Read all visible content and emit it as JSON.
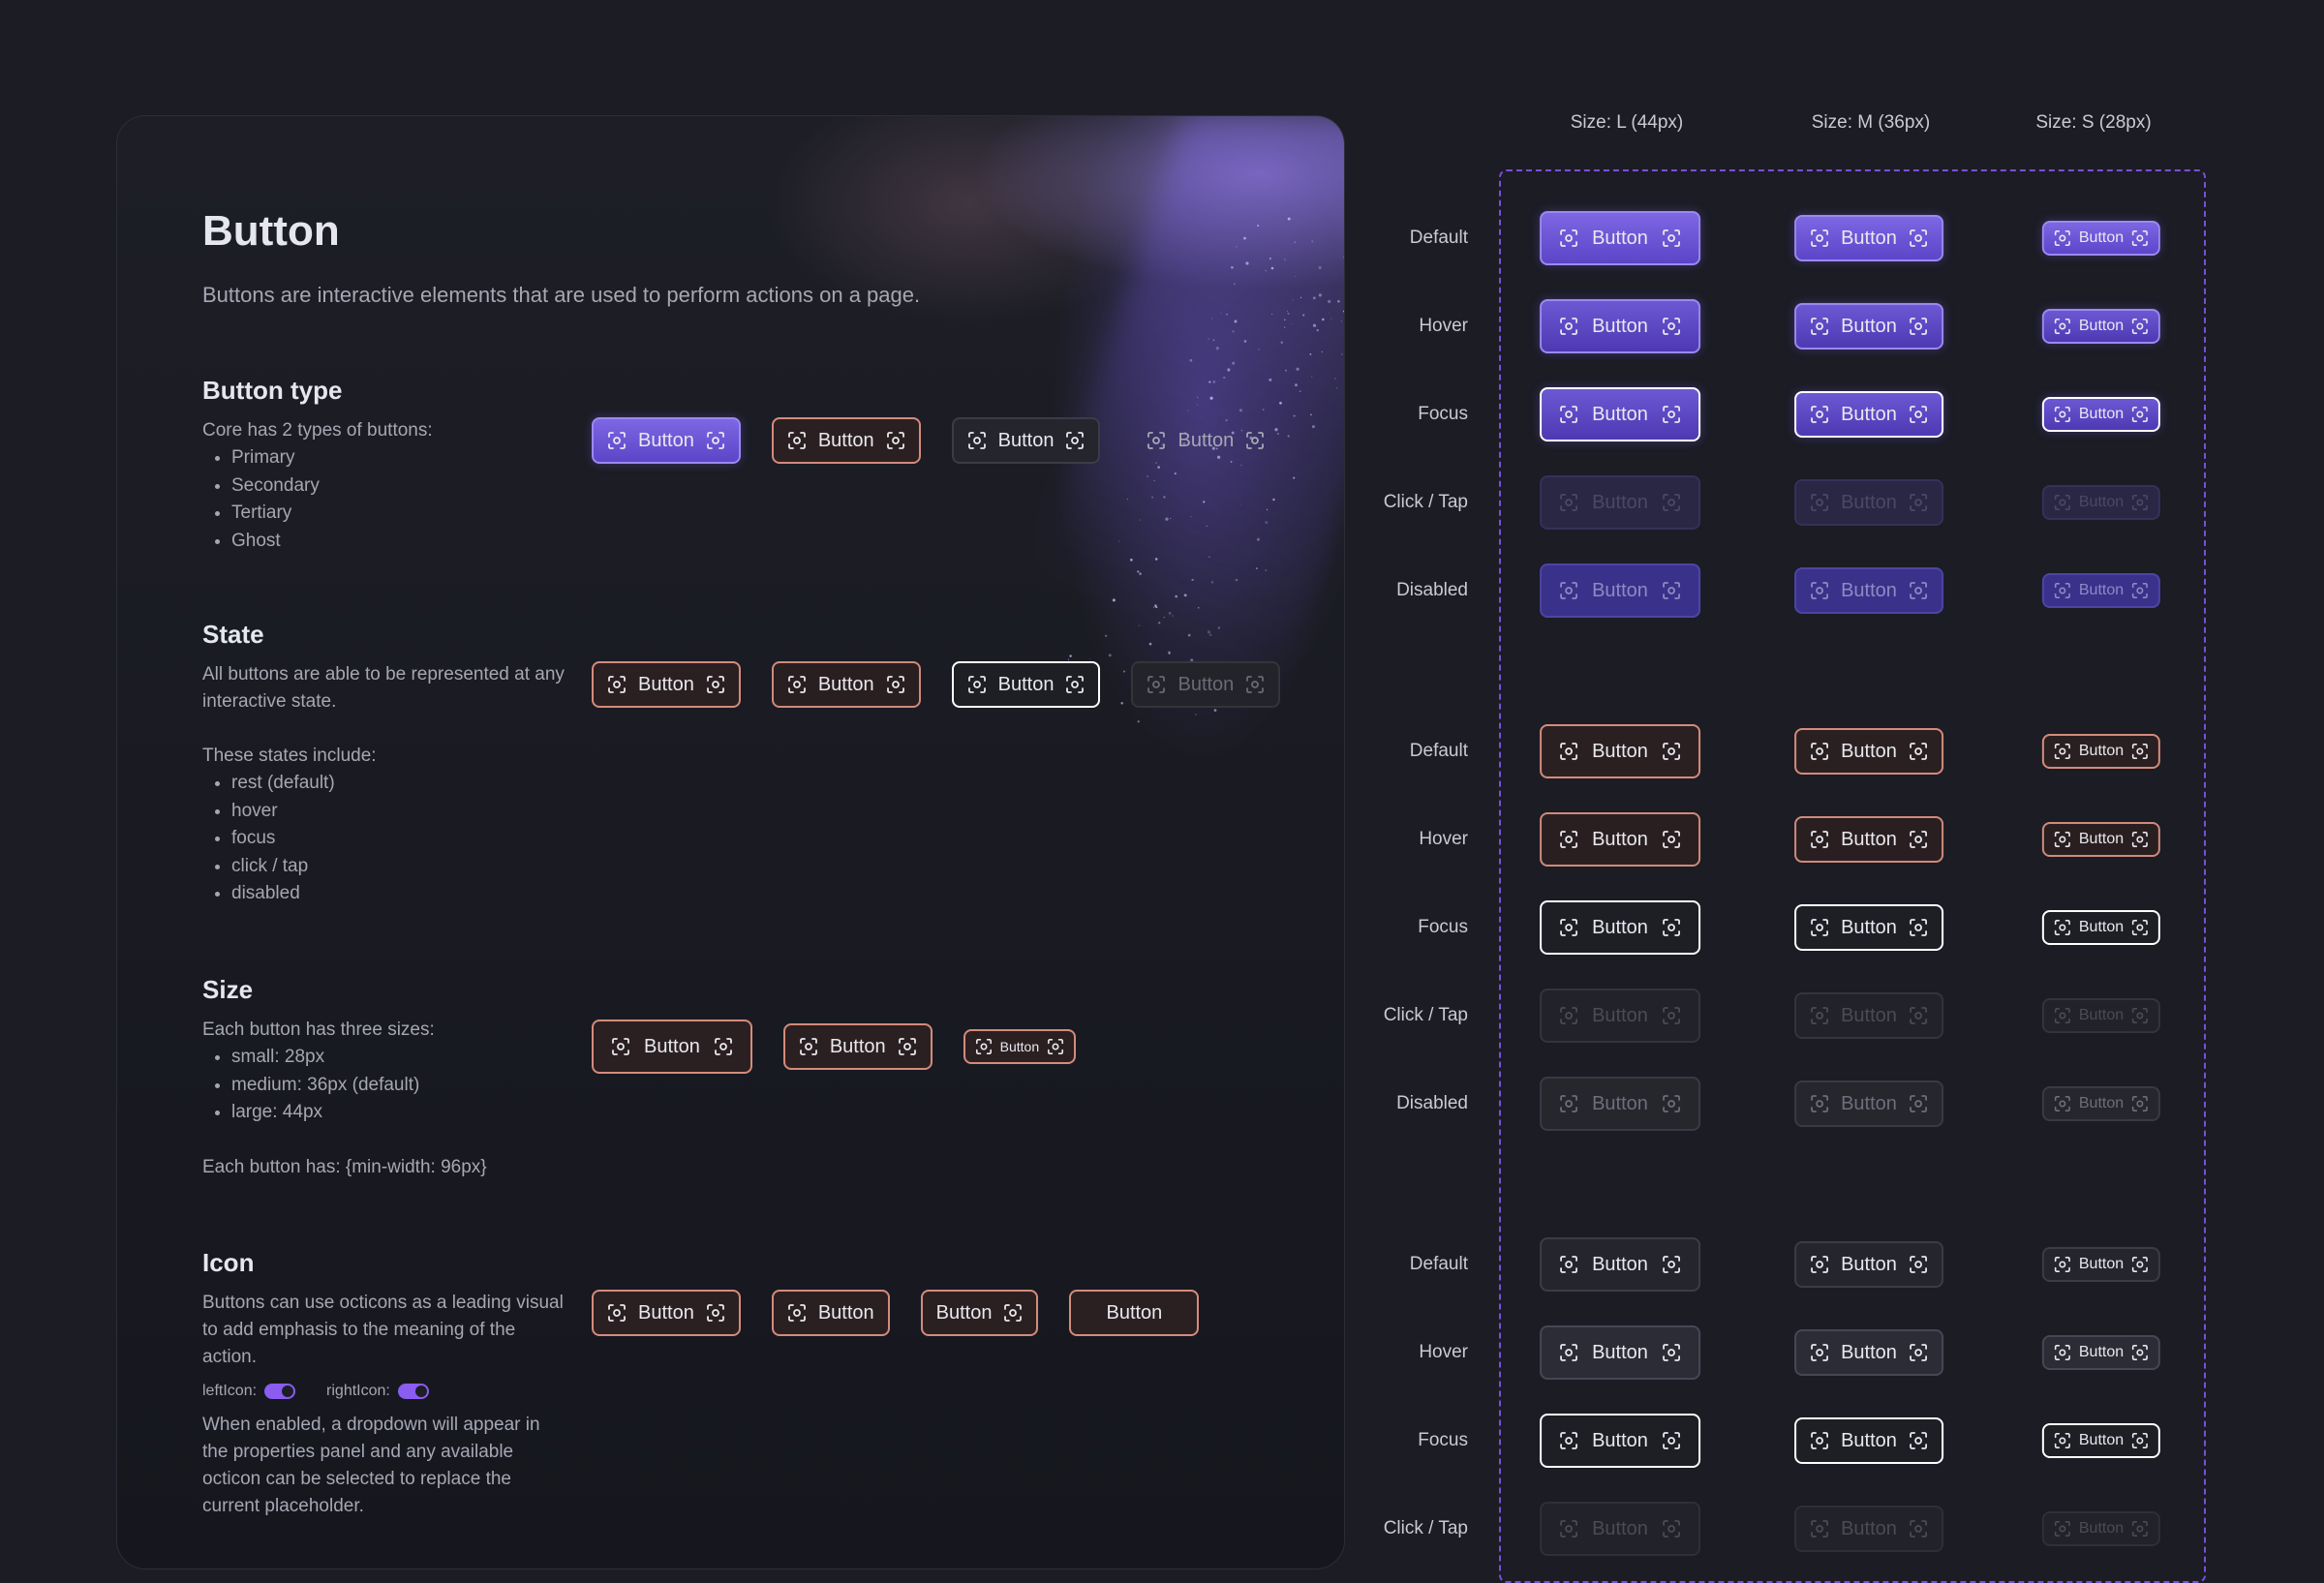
{
  "doc": {
    "title": "Button",
    "subtitle": "Buttons are interactive elements that are used to perform actions on a page.",
    "button_label": "Button",
    "type_section": {
      "heading": "Button type",
      "intro": "Core has 2 types of buttons:",
      "items": [
        "Primary",
        "Secondary",
        "Tertiary",
        "Ghost"
      ]
    },
    "state_section": {
      "heading": "State",
      "intro": "All buttons are able to be represented at any interactive state.",
      "intro2": "These states include:",
      "items": [
        "rest (default)",
        "hover",
        "focus",
        "click / tap",
        "disabled"
      ]
    },
    "size_section": {
      "heading": "Size",
      "intro": "Each button has three sizes:",
      "items": [
        "small: 28px",
        "medium: 36px (default)",
        "large: 44px"
      ],
      "note": "Each button has: {min-width: 96px}"
    },
    "icon_section": {
      "heading": "Icon",
      "intro": "Buttons can use octicons as a leading visual to add emphasis to the meaning of the action.",
      "toggle_left": "leftIcon:",
      "toggle_right": "rightIcon:",
      "outro": "When enabled, a dropdown will appear in the properties panel and any available octicon can be selected to replace the current placeholder."
    }
  },
  "matrix": {
    "columns": [
      "Size: L (44px)",
      "Size: M (36px)",
      "Size: S (28px)"
    ],
    "groups": [
      {
        "type": "primary",
        "states": [
          "Default",
          "Hover",
          "Focus",
          "Click / Tap",
          "Disabled"
        ]
      },
      {
        "type": "secondary",
        "states": [
          "Default",
          "Hover",
          "Focus",
          "Click / Tap",
          "Disabled"
        ]
      },
      {
        "type": "tertiary",
        "states": [
          "Default",
          "Hover",
          "Focus",
          "Click / Tap"
        ]
      }
    ],
    "button_label": "Button"
  },
  "colors": {
    "background": "#1b1c24",
    "primary": "#6b55d6",
    "secondary_border": "#d48b7c",
    "focus_border": "#ffffff",
    "frame_dash": "#7a4fd6"
  },
  "icons": {
    "placeholder": "focus-frame-icon",
    "toggle": "toggle-switch-icon"
  }
}
